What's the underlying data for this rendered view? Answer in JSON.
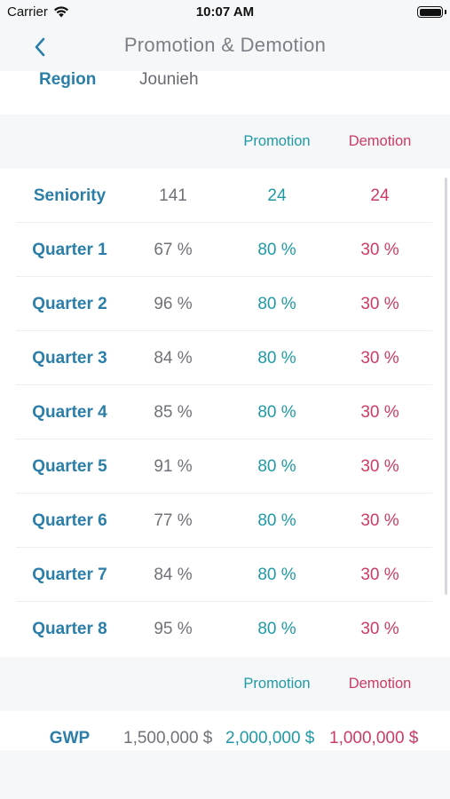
{
  "status_bar": {
    "carrier": "Carrier",
    "time": "10:07 AM"
  },
  "nav": {
    "title": "Promotion & Demotion"
  },
  "region": {
    "label": "Region",
    "value": "Jounieh"
  },
  "headers": {
    "promotion": "Promotion",
    "demotion": "Demotion"
  },
  "rows": [
    {
      "label": "Seniority",
      "value": "141",
      "promotion": "24",
      "demotion": "24"
    },
    {
      "label": "Quarter 1",
      "value": "67 %",
      "promotion": "80 %",
      "demotion": "30 %"
    },
    {
      "label": "Quarter 2",
      "value": "96 %",
      "promotion": "80 %",
      "demotion": "30 %"
    },
    {
      "label": "Quarter 3",
      "value": "84 %",
      "promotion": "80 %",
      "demotion": "30 %"
    },
    {
      "label": "Quarter 4",
      "value": "85 %",
      "promotion": "80 %",
      "demotion": "30 %"
    },
    {
      "label": "Quarter 5",
      "value": "91 %",
      "promotion": "80 %",
      "demotion": "30 %"
    },
    {
      "label": "Quarter 6",
      "value": "77 %",
      "promotion": "80 %",
      "demotion": "30 %"
    },
    {
      "label": "Quarter 7",
      "value": "84 %",
      "promotion": "80 %",
      "demotion": "30 %"
    },
    {
      "label": "Quarter 8",
      "value": "95 %",
      "promotion": "80 %",
      "demotion": "30 %"
    }
  ],
  "gwp": {
    "label": "GWP",
    "value": "1,500,000 $",
    "promotion": "2,000,000 $",
    "demotion": "1,000,000 $"
  },
  "colors": {
    "accent_blue": "#2a7ea8",
    "promotion_teal": "#1f9aa5",
    "demotion_red": "#cc3b63",
    "background_gray": "#f6f7f8"
  },
  "icons": {
    "back": "chevron-left-icon",
    "wifi": "wifi-icon",
    "battery": "battery-icon"
  }
}
